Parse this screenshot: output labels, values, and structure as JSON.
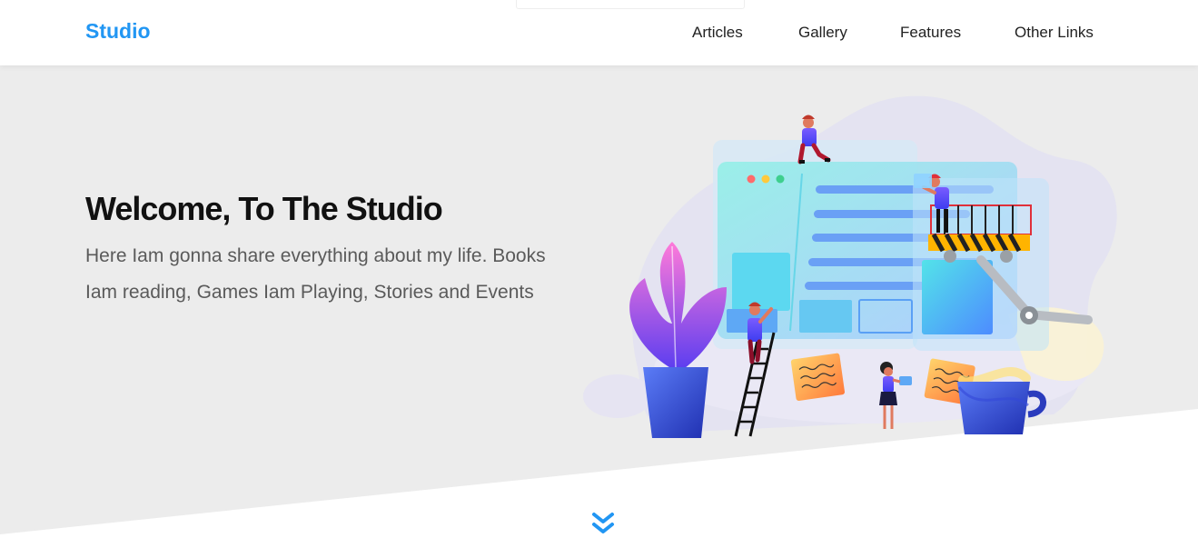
{
  "header": {
    "logo": "Studio",
    "nav": [
      {
        "label": "Articles"
      },
      {
        "label": "Gallery"
      },
      {
        "label": "Features"
      },
      {
        "label": "Other Links"
      }
    ]
  },
  "hero": {
    "title": "Welcome, To The Studio",
    "description": "Here Iam gonna share everything about my life. Books Iam reading, Games Iam Playing, Stories and Events"
  },
  "colors": {
    "accent": "#2196f3",
    "hero_background": "#ececec"
  },
  "icons": {
    "scroll_down": "double-chevron-down-icon"
  }
}
